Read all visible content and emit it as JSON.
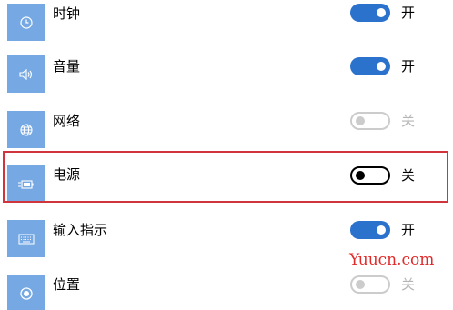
{
  "rows": [
    {
      "label": "时钟",
      "state_label": "开",
      "state": "on",
      "icon": "clock-icon"
    },
    {
      "label": "音量",
      "state_label": "开",
      "state": "on",
      "icon": "volume-icon"
    },
    {
      "label": "网络",
      "state_label": "关",
      "state": "disabled",
      "icon": "globe-icon"
    },
    {
      "label": "电源",
      "state_label": "关",
      "state": "off",
      "icon": "battery-icon"
    },
    {
      "label": "输入指示",
      "state_label": "开",
      "state": "on",
      "icon": "keyboard-icon"
    },
    {
      "label": "位置",
      "state_label": "关",
      "state": "disabled",
      "icon": "location-icon"
    }
  ],
  "colors": {
    "tile": "#76a9e4",
    "toggle_on": "#2b72cc",
    "toggle_off_border": "#000000",
    "toggle_disabled": "#cccccc",
    "highlight": "#d0343c",
    "watermark": "#e12a2a"
  },
  "highlighted_row": "电源",
  "watermark": "Yuucn.com"
}
